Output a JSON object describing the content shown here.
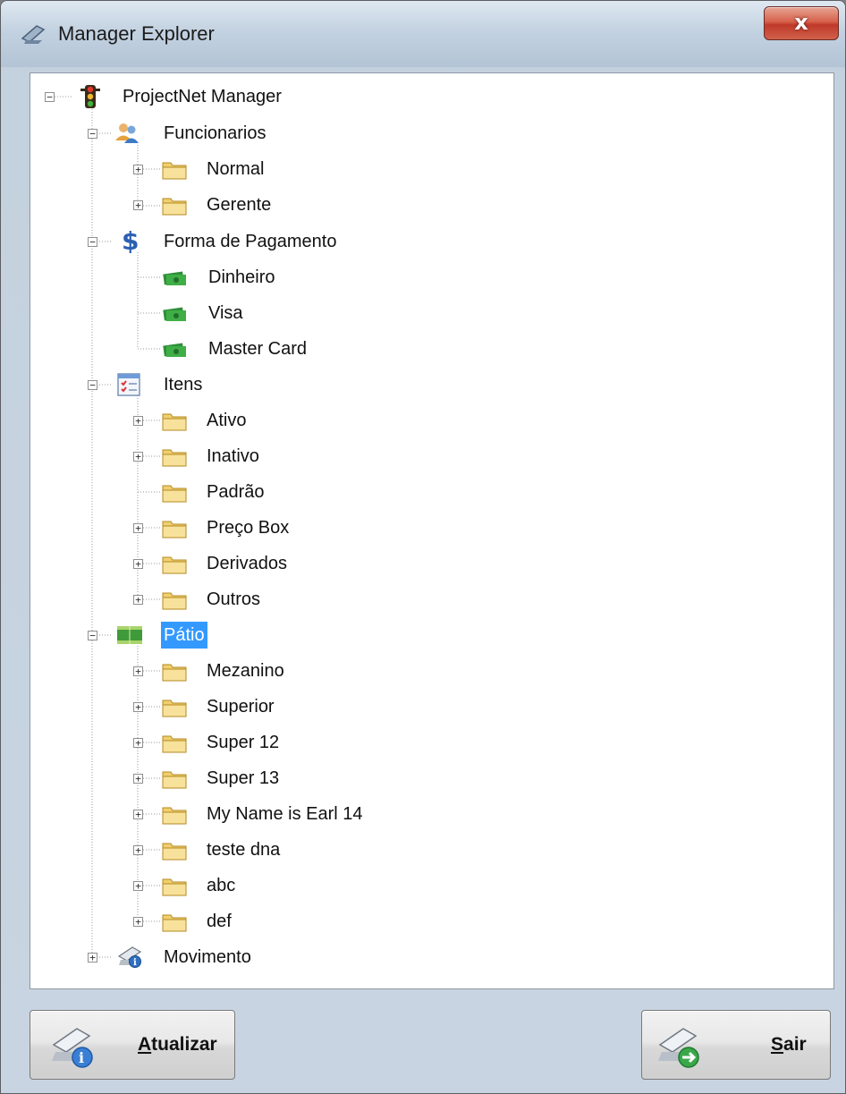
{
  "window": {
    "title": "Manager Explorer",
    "close_label": "x"
  },
  "tree": {
    "root": {
      "label": "ProjectNet Manager",
      "icon": "traffic-light-icon"
    },
    "funcionarios": {
      "label": "Funcionarios",
      "icon": "users-icon",
      "children": [
        "Normal",
        "Gerente"
      ]
    },
    "pagamento": {
      "label": "Forma de Pagamento",
      "icon": "dollar-icon",
      "children": [
        "Dinheiro",
        "Visa",
        "Master Card"
      ]
    },
    "itens": {
      "label": "Itens",
      "icon": "checklist-icon",
      "children": [
        "Ativo",
        "Inativo",
        "Padrão",
        "Preço Box",
        "Derivados",
        "Outros"
      ]
    },
    "patio": {
      "label": "Pátio",
      "icon": "field-icon",
      "selected": true,
      "children": [
        "Mezanino",
        "Superior",
        "Super 12",
        "Super 13",
        "My Name is Earl 14",
        "teste dna",
        "abc",
        "def"
      ]
    },
    "movimento": {
      "label": "Movimento",
      "icon": "info-printer-icon"
    }
  },
  "buttons": {
    "atualizar": {
      "mnemonic": "A",
      "rest": "tualizar",
      "icon": "refresh-info-icon"
    },
    "sair": {
      "mnemonic": "S",
      "rest": "air",
      "icon": "exit-arrow-icon"
    }
  },
  "colors": {
    "selection": "#3399ff",
    "close_button": "#c0392b"
  }
}
